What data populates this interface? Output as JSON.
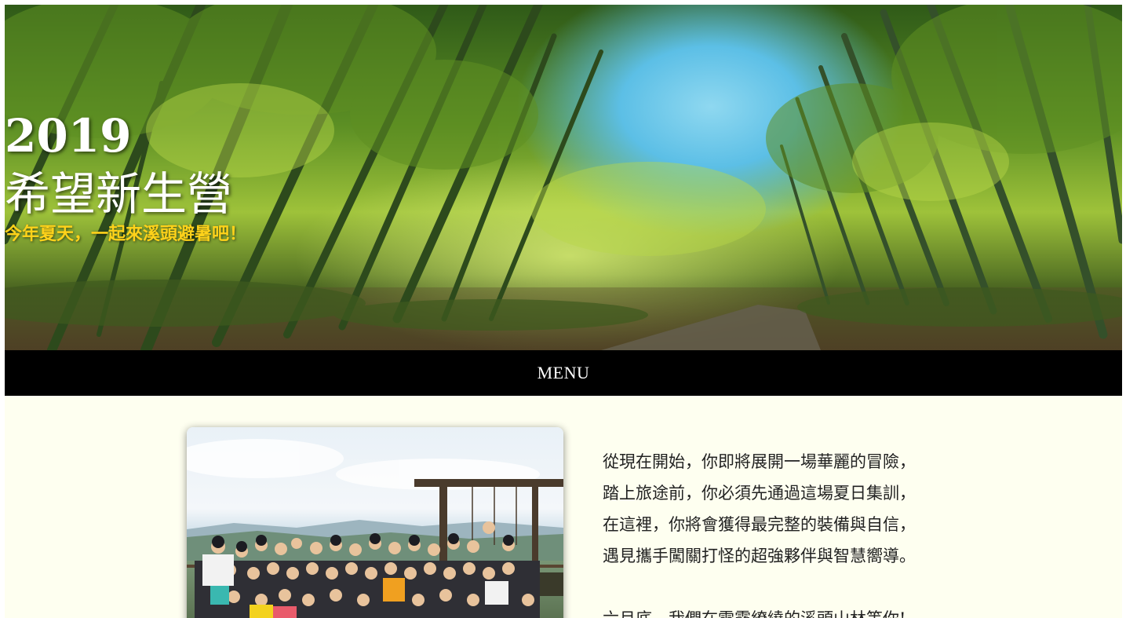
{
  "hero": {
    "year": "2019",
    "title": "希望新生營",
    "subtitle": "今年夏天，一起來溪頭避暑吧！"
  },
  "nav": {
    "menu_label": "MENU"
  },
  "intro": {
    "lines": [
      "從現在開始，你即將展開一場華麗的冒險，",
      "踏上旅途前，你必須先通過這場夏日集訓，",
      "在這裡，你將會獲得最完整的裝備與自信，",
      "遇見攜手闖關打怪的超強夥伴與智慧嚮導。"
    ],
    "closing": "六月底，我們在雲霧繚繞的溪頭山林等你!"
  },
  "colors": {
    "page_background": "#fefff0",
    "menu_background": "#000000",
    "subtitle": "#ffd21a"
  }
}
